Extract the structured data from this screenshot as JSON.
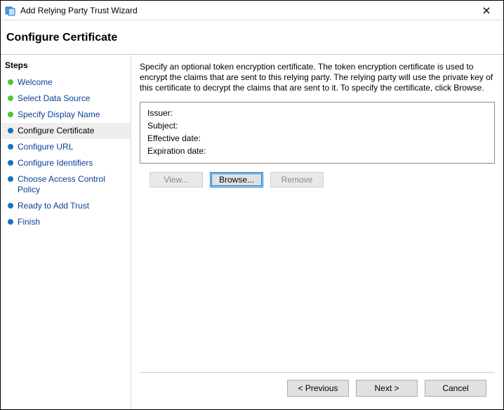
{
  "titlebar": {
    "title": "Add Relying Party Trust Wizard"
  },
  "header": {
    "title": "Configure Certificate"
  },
  "sidebar": {
    "title": "Steps",
    "items": [
      {
        "label": "Welcome",
        "state": "done"
      },
      {
        "label": "Select Data Source",
        "state": "done"
      },
      {
        "label": "Specify Display Name",
        "state": "done"
      },
      {
        "label": "Configure Certificate",
        "state": "current"
      },
      {
        "label": "Configure URL",
        "state": "pending"
      },
      {
        "label": "Configure Identifiers",
        "state": "pending"
      },
      {
        "label": "Choose Access Control Policy",
        "state": "pending"
      },
      {
        "label": "Ready to Add Trust",
        "state": "pending"
      },
      {
        "label": "Finish",
        "state": "pending"
      }
    ]
  },
  "main": {
    "description": "Specify an optional token encryption certificate.  The token encryption certificate is used to encrypt the claims that are sent to this relying party.  The relying party will use the private key of this certificate to decrypt the claims that are sent to it.  To specify the certificate, click Browse.",
    "cert_fields": {
      "issuer_label": "Issuer:",
      "issuer_value": "",
      "subject_label": "Subject:",
      "subject_value": "",
      "effective_label": "Effective date:",
      "effective_value": "",
      "expiration_label": "Expiration date:",
      "expiration_value": ""
    },
    "buttons": {
      "view": "View...",
      "browse": "Browse...",
      "remove": "Remove"
    }
  },
  "footer": {
    "previous": "< Previous",
    "next": "Next >",
    "cancel": "Cancel"
  }
}
